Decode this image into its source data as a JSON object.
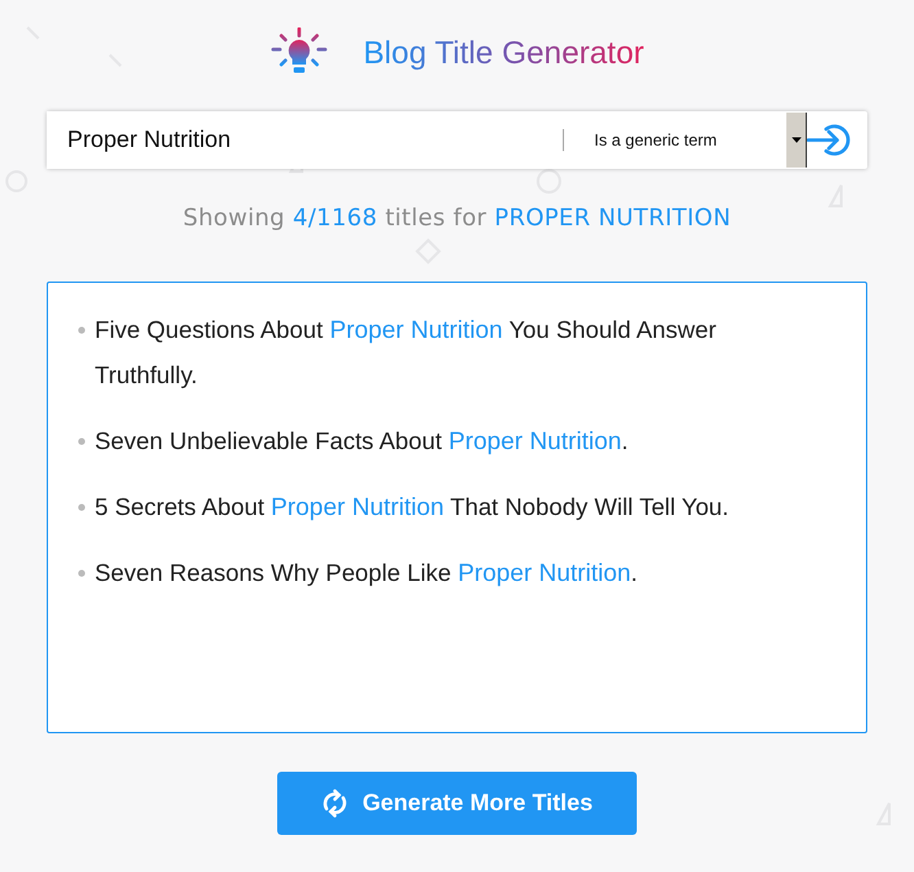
{
  "header": {
    "title": "Blog Title Generator"
  },
  "search": {
    "value": "Proper Nutrition",
    "filter": "Is a generic term"
  },
  "summary": {
    "prefix": "Showing",
    "count": "4/1168",
    "middle": "titles for",
    "keyword": "PROPER NUTRITION"
  },
  "titles": [
    "Five Questions About **Proper Nutrition** You Should Answer Truthfully.",
    "Seven Unbelievable Facts About **Proper Nutrition**.",
    "5 Secrets About **Proper Nutrition** That Nobody Will Tell You.",
    "Seven Reasons Why People Like **Proper Nutrition**."
  ],
  "button": {
    "label": "Generate More Titles"
  }
}
